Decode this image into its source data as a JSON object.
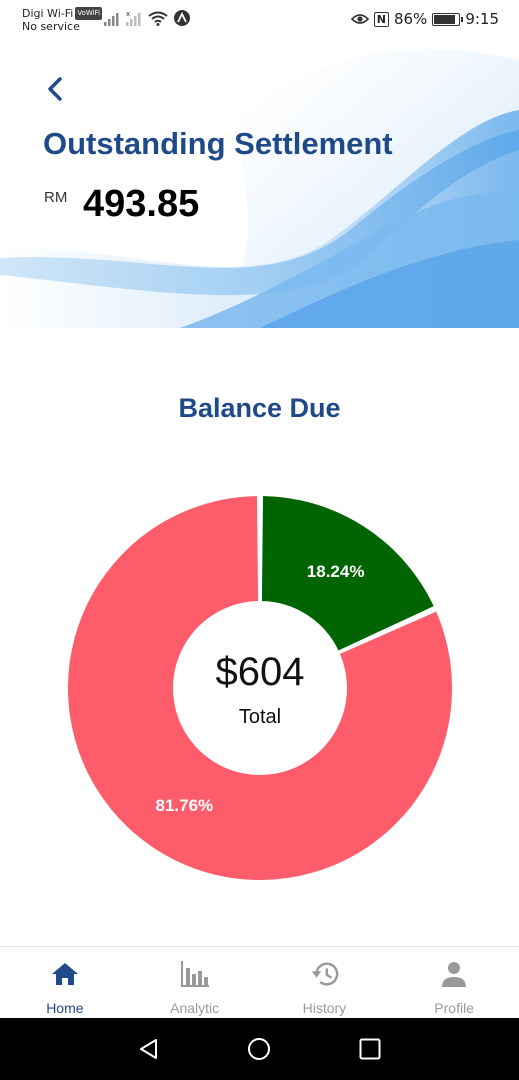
{
  "status_bar": {
    "carrier": "Digi Wi-Fi",
    "vowifi_badge": "VoWiFi",
    "service": "No service",
    "nfc": "N",
    "battery_percent": "86%",
    "time": "9:15",
    "battery_level": 0.86
  },
  "header": {
    "title": "Outstanding Settlement",
    "currency": "RM",
    "amount": "493.85"
  },
  "section": {
    "title": "Balance Due"
  },
  "chart_data": {
    "type": "pie",
    "donut": true,
    "slices": [
      {
        "label": "18.24%",
        "value": 18.24,
        "color": "#006400"
      },
      {
        "label": "81.76%",
        "value": 81.76,
        "color": "#fd5d6a"
      }
    ],
    "center_value": "$604",
    "center_label": "Total"
  },
  "bottom_nav": {
    "items": [
      {
        "label": "Home",
        "icon": "home-icon",
        "active": true
      },
      {
        "label": "Analytic",
        "icon": "bar-chart-icon",
        "active": false
      },
      {
        "label": "History",
        "icon": "history-icon",
        "active": false
      },
      {
        "label": "Profile",
        "icon": "person-icon",
        "active": false
      }
    ]
  },
  "colors": {
    "brand": "#1f4a8a",
    "inactive": "#9a9a9a",
    "paid": "#006400",
    "due": "#fd5d6a"
  }
}
